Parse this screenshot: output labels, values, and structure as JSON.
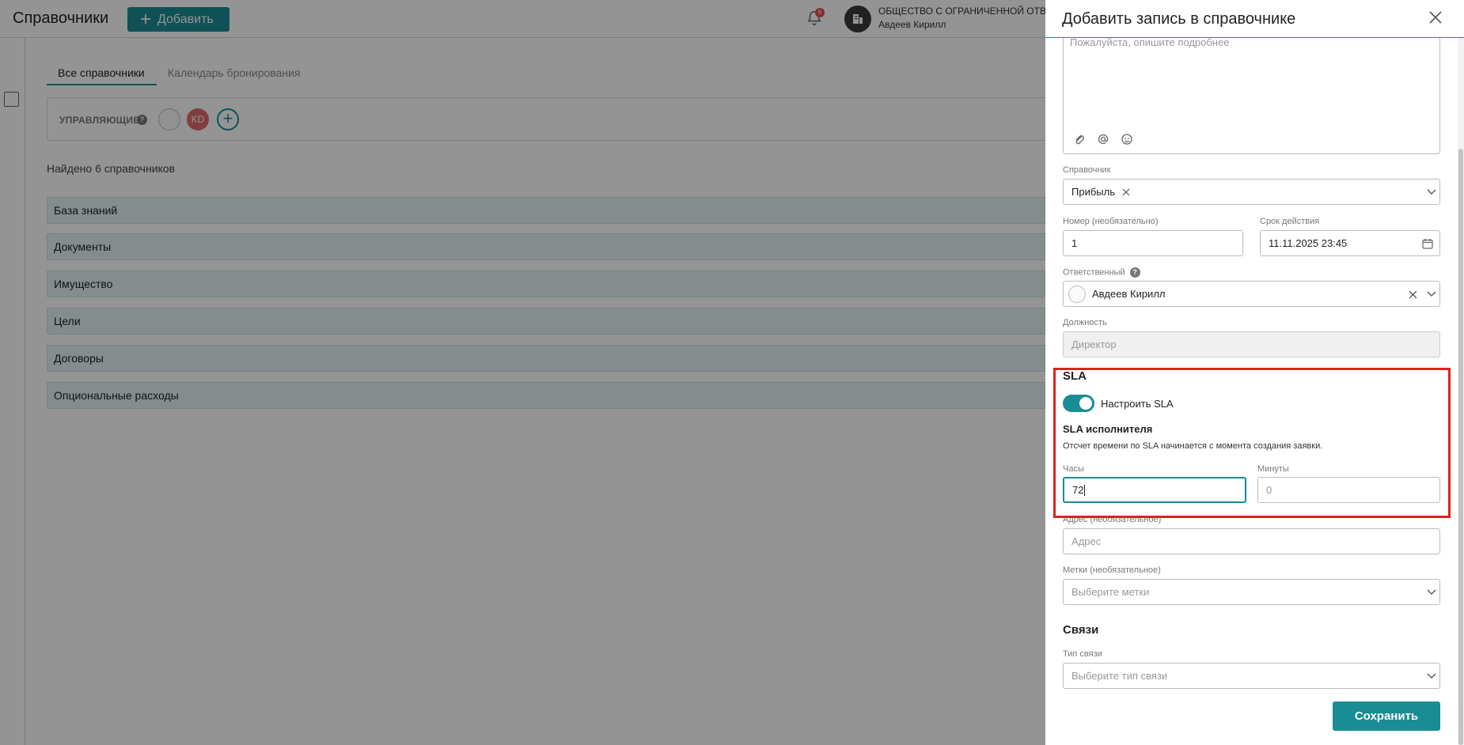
{
  "app": {
    "title": "Справочники",
    "add_label": "Добавить",
    "notifications_count": "6",
    "org_name": "ОБЩЕСТВО С ОГРАНИЧЕННОЙ ОТВЕТСТ",
    "user_name": "Авдеев Кирилл"
  },
  "tabs": [
    {
      "label": "Все справочники",
      "active": true
    },
    {
      "label": "Календарь бронирования",
      "active": false
    }
  ],
  "managers": {
    "label": "УПРАВЛЯЮЩИЕ",
    "help": "?",
    "avatar2_initials": "KD"
  },
  "found_text": "Найдено 6 справочников",
  "directories": [
    "База знаний",
    "Документы",
    "Имущество",
    "Цели",
    "Договоры",
    "Опциональные расходы"
  ],
  "drawer": {
    "title": "Добавить запись в справочнике",
    "description_placeholder": "Пожалуйста, опишите подробнее",
    "directory_label": "Справочник",
    "directory_value": "Прибыль",
    "number_label": "Номер (необязательно)",
    "number_value": "1",
    "validity_label": "Срок действия",
    "validity_value": "11.11.2025 23:45",
    "responsible_label": "Ответственный",
    "responsible_value": "Авдеев Кирилл",
    "position_label": "Должность",
    "position_placeholder": "Директор",
    "sla_title": "SLA",
    "sla_toggle_label": "Настроить SLA",
    "sla_toggle_on": true,
    "sla_exec_title": "SLA исполнителя",
    "sla_note": "Отсчет времени по SLA начинается с момента создания заявки.",
    "hours_label": "Часы",
    "hours_value": "72",
    "minutes_label": "Минуты",
    "minutes_placeholder": "0",
    "address_label": "Адрес (необязательное)",
    "address_placeholder": "Адрес",
    "tags_label": "Метки (необязательное)",
    "tags_placeholder": "Выберите метки",
    "links_title": "Связи",
    "link_type_label": "Тип связи",
    "link_type_placeholder": "Выберите тип связи",
    "save_label": "Сохранить"
  },
  "colors": {
    "accent": "#1a8c94",
    "highlight": "#e02020",
    "badge": "#e74c4c"
  }
}
